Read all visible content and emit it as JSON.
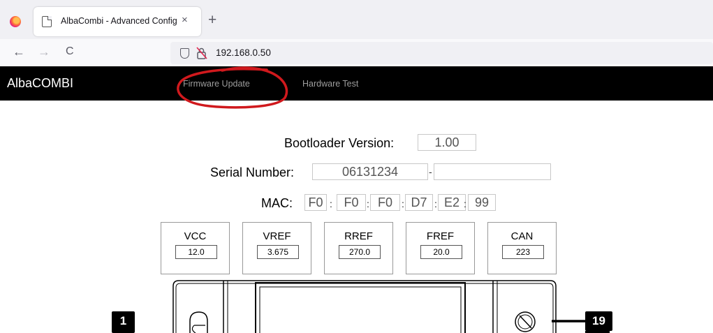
{
  "browser": {
    "tab_title": "AlbaCombi - Advanced Config",
    "tab_close": "×",
    "new_tab": "+",
    "back": "←",
    "forward": "→",
    "reload": "C",
    "url": "192.168.0.50"
  },
  "app": {
    "brand": "AlbaCOMBI",
    "menu": {
      "firmware_update": "Firmware Update",
      "hardware_test": "Hardware Test"
    }
  },
  "config": {
    "bootloader_label": "Bootloader Version:",
    "bootloader_value": "1.00",
    "serial_label": "Serial Number:",
    "serial_value": "06131234",
    "serial_suffix": "",
    "serial_dash": "-",
    "mac_label": "MAC:",
    "mac_sep": ":",
    "mac": [
      "F0",
      "F0",
      "F0",
      "D7",
      "E2",
      "99"
    ]
  },
  "measurements": [
    {
      "name": "VCC",
      "value": "12.0"
    },
    {
      "name": "VREF",
      "value": "3.675"
    },
    {
      "name": "RREF",
      "value": "270.0"
    },
    {
      "name": "FREF",
      "value": "20.0"
    },
    {
      "name": "CAN",
      "value": "223"
    }
  ],
  "device": {
    "marker_left": "1",
    "marker_right": "19"
  },
  "annotation": {
    "color": "#d0191d"
  }
}
